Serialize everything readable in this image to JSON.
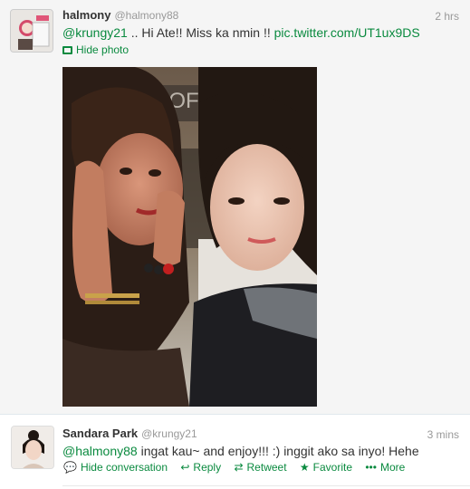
{
  "tweets": [
    {
      "fullname": "halmony",
      "username": "@halmony88",
      "time": "2 hrs",
      "mention": "@krungy21",
      "text_body": " .. Hi Ate!! Miss ka nmin !! ",
      "link": "pic.twitter.com/UT1ux9DS",
      "hide_photo_label": "Hide photo"
    },
    {
      "fullname": "Sandara Park",
      "username": "@krungy21",
      "time": "3 mins",
      "mention": "@halmony88",
      "text_body": " ingat kau~ and enjoy!!! :) inggit ako sa inyo! Hehe",
      "actions": {
        "hide_conversation": "Hide conversation",
        "reply": "Reply",
        "retweet": "Retweet",
        "favorite": "Favorite",
        "more": "More"
      }
    }
  ],
  "colors": {
    "link": "#0a8a3f",
    "muted": "#999999",
    "tweet_bg": "#f5f5f5"
  },
  "icons": [
    "photo-icon",
    "speech-bubble-icon",
    "reply-arrow-icon",
    "retweet-icon",
    "star-icon",
    "ellipsis-icon"
  ]
}
